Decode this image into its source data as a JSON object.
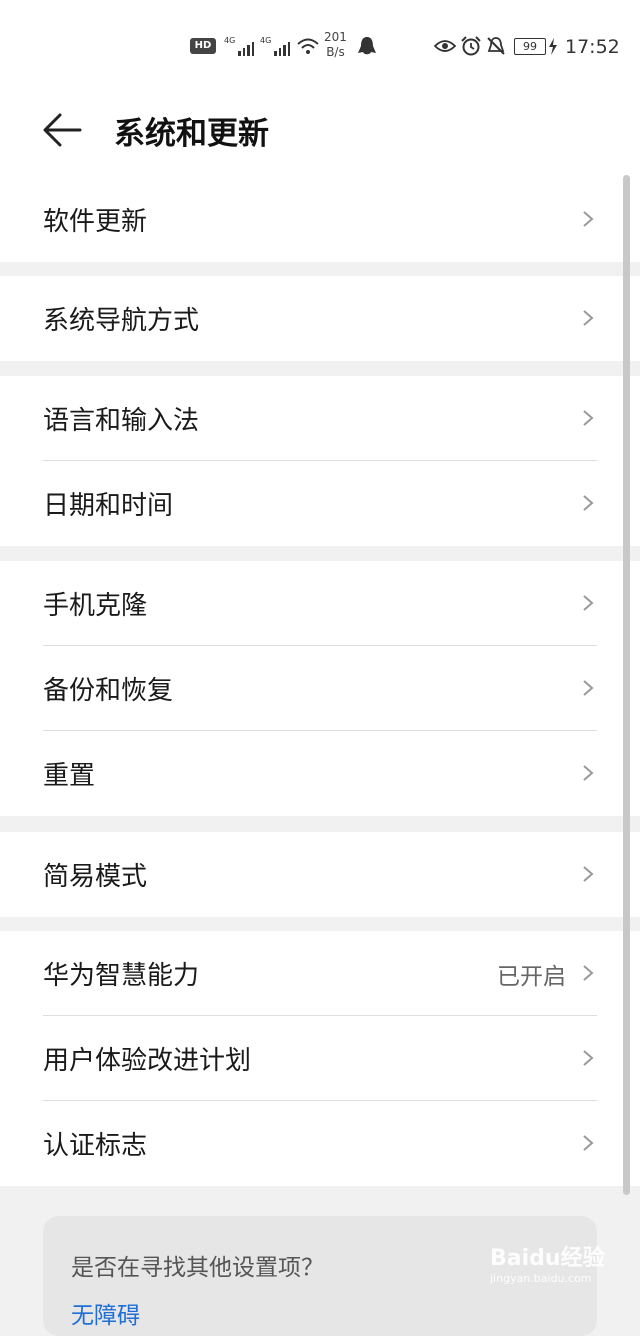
{
  "status_bar": {
    "hd": "HD",
    "signal_1_label": "4G",
    "signal_2_label": "4G",
    "speed_value": "201",
    "speed_unit": "B/s",
    "battery": "99",
    "time": "17:52"
  },
  "header": {
    "title": "系统和更新"
  },
  "groups": [
    {
      "items": [
        {
          "label": "软件更新"
        }
      ]
    },
    {
      "items": [
        {
          "label": "系统导航方式"
        }
      ]
    },
    {
      "items": [
        {
          "label": "语言和输入法"
        },
        {
          "label": "日期和时间"
        }
      ]
    },
    {
      "items": [
        {
          "label": "手机克隆"
        },
        {
          "label": "备份和恢复"
        },
        {
          "label": "重置"
        }
      ]
    },
    {
      "items": [
        {
          "label": "简易模式"
        }
      ]
    },
    {
      "items": [
        {
          "label": "华为智慧能力",
          "value": "已开启"
        },
        {
          "label": "用户体验改进计划"
        },
        {
          "label": "认证标志"
        }
      ]
    }
  ],
  "suggestion": {
    "question": "是否在寻找其他设置项？",
    "link": "无障碍"
  },
  "watermark": {
    "brand": "Baidu经验",
    "url": "jingyan.baidu.com"
  }
}
